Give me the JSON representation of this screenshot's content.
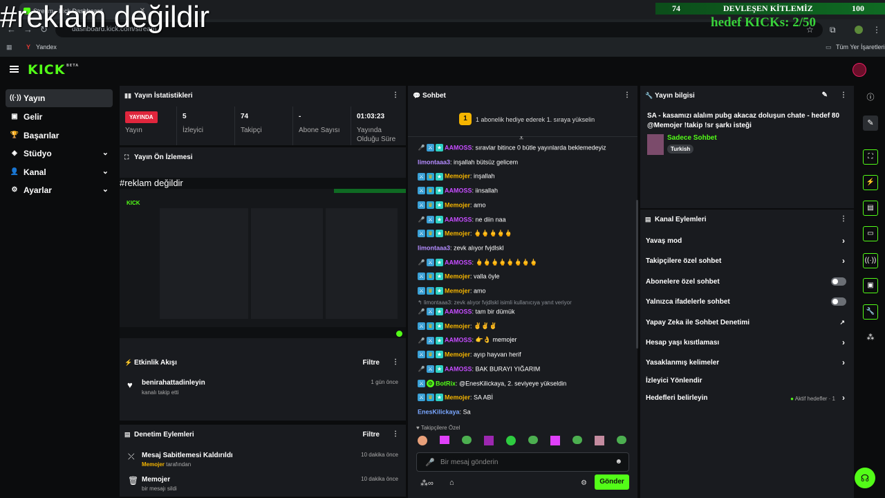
{
  "browser": {
    "tab_title": "Stream - Kick Dashboard",
    "url": "dashboard.kick.com/stream",
    "bookmark_yandex": "Yandex",
    "bookmark_all": "Tüm Yer İşaretleri"
  },
  "overlay": {
    "caption": "#reklam değildir",
    "count_left": "74",
    "title": "DEVLEŞEN KİTLEMİZ",
    "count_right": "100",
    "hedef": "hedef KICKs: 2/50"
  },
  "app": {
    "logo": "KICK",
    "logo_tag": "BETA"
  },
  "sidebar": {
    "items": [
      {
        "label": "Yayın",
        "icon": "broadcast-icon"
      },
      {
        "label": "Gelir",
        "icon": "money-icon"
      },
      {
        "label": "Başarılar",
        "icon": "trophy-icon"
      },
      {
        "label": "Stüdyo",
        "icon": "layers-icon"
      },
      {
        "label": "Kanal",
        "icon": "user-icon"
      },
      {
        "label": "Ayarlar",
        "icon": "gear-icon"
      }
    ]
  },
  "stats": {
    "title": "Yayın İstatistikleri",
    "live_badge": "YAYINDA",
    "live_label": "Yayın",
    "viewers_value": "5",
    "viewers_label": "İzleyici",
    "followers_value": "74",
    "followers_label": "Takipçi",
    "subs_value": "-",
    "subs_label": "Abone Sayısı",
    "uptime_value": "01:03:23",
    "uptime_label": "Yayında Olduğu Süre"
  },
  "preview": {
    "title": "Yayın Ön İzlemesi",
    "overlay_caption": "#reklam değildir"
  },
  "activity": {
    "title": "Etkinlik Akışı",
    "filter": "Filtre",
    "items": [
      {
        "user": "benirahattadinleyin",
        "desc": "kanalı takip etti",
        "time": "1 gün önce"
      }
    ]
  },
  "moderation": {
    "title": "Denetim Eylemleri",
    "filter": "Filtre",
    "items": [
      {
        "action": "Mesaj Sabitlemesi Kaldırıldı",
        "by_user": "Memojer",
        "by_suffix": " tarafından",
        "time": "10 dakika önce"
      },
      {
        "action": "Memojer",
        "desc": "bir mesajı sildi",
        "time": "10 dakika önce"
      }
    ]
  },
  "chat": {
    "title": "Sohbet",
    "promo": "1 abonelik hediye ederek 1. sıraya yükselin",
    "promo_rank": "1",
    "messages": [
      {
        "user": "AAMOSS",
        "color": "#c64dff",
        "badges": "mic,sword,sub",
        "text": "sıravlar bitince 0 bütle yayınlarda beklemedeyiz"
      },
      {
        "user": "limontaaa3",
        "color": "#b48cff",
        "badges": "",
        "text": "inşallah bütsüz gelicem"
      },
      {
        "user": "Memojer",
        "color": "#f5b500",
        "badges": "sword,crown,sub",
        "text": "inşallah"
      },
      {
        "user": "AAMOSS",
        "color": "#c64dff",
        "badges": "sword,crown,sub",
        "text": "iinsallah"
      },
      {
        "user": "Memojer",
        "color": "#f5b500",
        "badges": "sword,crown,sub",
        "text": "amo"
      },
      {
        "user": "AAMOSS",
        "color": "#c64dff",
        "badges": "mic,sword,sub",
        "text": "ne diin naa"
      },
      {
        "user": "Memojer",
        "color": "#f5b500",
        "badges": "sword,crown,sub",
        "text": "🖕🖕🖕🖕🖕"
      },
      {
        "user": "limontaaa3",
        "color": "#b48cff",
        "badges": "",
        "text": "zevk alıyor fvjdlskl"
      },
      {
        "user": "AAMOSS",
        "color": "#c64dff",
        "badges": "mic,sword,sub",
        "text": "🖕🖕🖕🖕🖕🖕🖕🖕"
      },
      {
        "user": "Memojer",
        "color": "#f5b500",
        "badges": "sword,crown,sub",
        "text": "valla öyle"
      },
      {
        "user": "Memojer",
        "color": "#f5b500",
        "badges": "sword,crown,sub",
        "text": "amo"
      },
      {
        "reply": "limontaaa3: zevk alıyor fvjdlskl isimli kullanıcıya yanıt veriyor"
      },
      {
        "user": "AAMOSS",
        "color": "#c64dff",
        "badges": "mic,sword,sub",
        "text": "tam bir dümük"
      },
      {
        "user": "Memojer",
        "color": "#f5b500",
        "badges": "sword,crown,sub",
        "text": "✌✌✌"
      },
      {
        "user": "AAMOSS",
        "color": "#c64dff",
        "badges": "mic,sword,sub",
        "text": "👉👌 memojer"
      },
      {
        "user": "Memojer",
        "color": "#f5b500",
        "badges": "sword,crown,sub",
        "text": "ayıp hayvan herif"
      },
      {
        "user": "AAMOSS",
        "color": "#c64dff",
        "badges": "mic,sword,sub",
        "text": "BAK BURAYI YIĞARIM"
      },
      {
        "user": "BotRix",
        "color": "#53fc18",
        "badges": "sword,gear",
        "text": "@EnesKilickaya, 2. seviyeye yükseldin"
      },
      {
        "user": "Memojer",
        "color": "#f5b500",
        "badges": "sword,crown,sub",
        "text": "SA ABİ"
      },
      {
        "user": "EnesKilickaya",
        "color": "#7aa7ff",
        "badges": "",
        "text": "Sa"
      }
    ],
    "emote_label": "Takipçilere Özel",
    "input_placeholder": "Bir mesaj gönderin",
    "send_label": "Gönder"
  },
  "stream_info": {
    "title": "Yayın bilgisi",
    "stream_title": "SA - kasamızı alalım pubg akacaz doluşun chate - hedef 80 @Memojer !takip !sr şarkı isteği",
    "category": "Sadece Sohbet",
    "language": "Turkish"
  },
  "channel_actions": {
    "title": "Kanal Eylemleri",
    "items": [
      {
        "label": "Yavaş mod",
        "type": "chevron"
      },
      {
        "label": "Takipçilere özel sohbet",
        "type": "chevron"
      },
      {
        "label": "Abonelere özel sohbet",
        "type": "toggle"
      },
      {
        "label": "Yalnızca ifadelerle sohbet",
        "type": "toggle"
      },
      {
        "label": "Yapay Zeka ile Sohbet Denetimi",
        "type": "external"
      },
      {
        "label": "Hesap yaşı kısıtlaması",
        "type": "chevron"
      },
      {
        "label": "Yasaklanmış kelimeler",
        "type": "chevron"
      },
      {
        "label": "İzleyici Yönlendir",
        "type": "none"
      },
      {
        "label": "Hedefleri belirleyin",
        "type": "chevron",
        "status": "Aktif hedefler · 1"
      }
    ]
  },
  "colors": {
    "accent": "#53fc18",
    "live": "#e0263d",
    "panel": "#191b1f"
  }
}
